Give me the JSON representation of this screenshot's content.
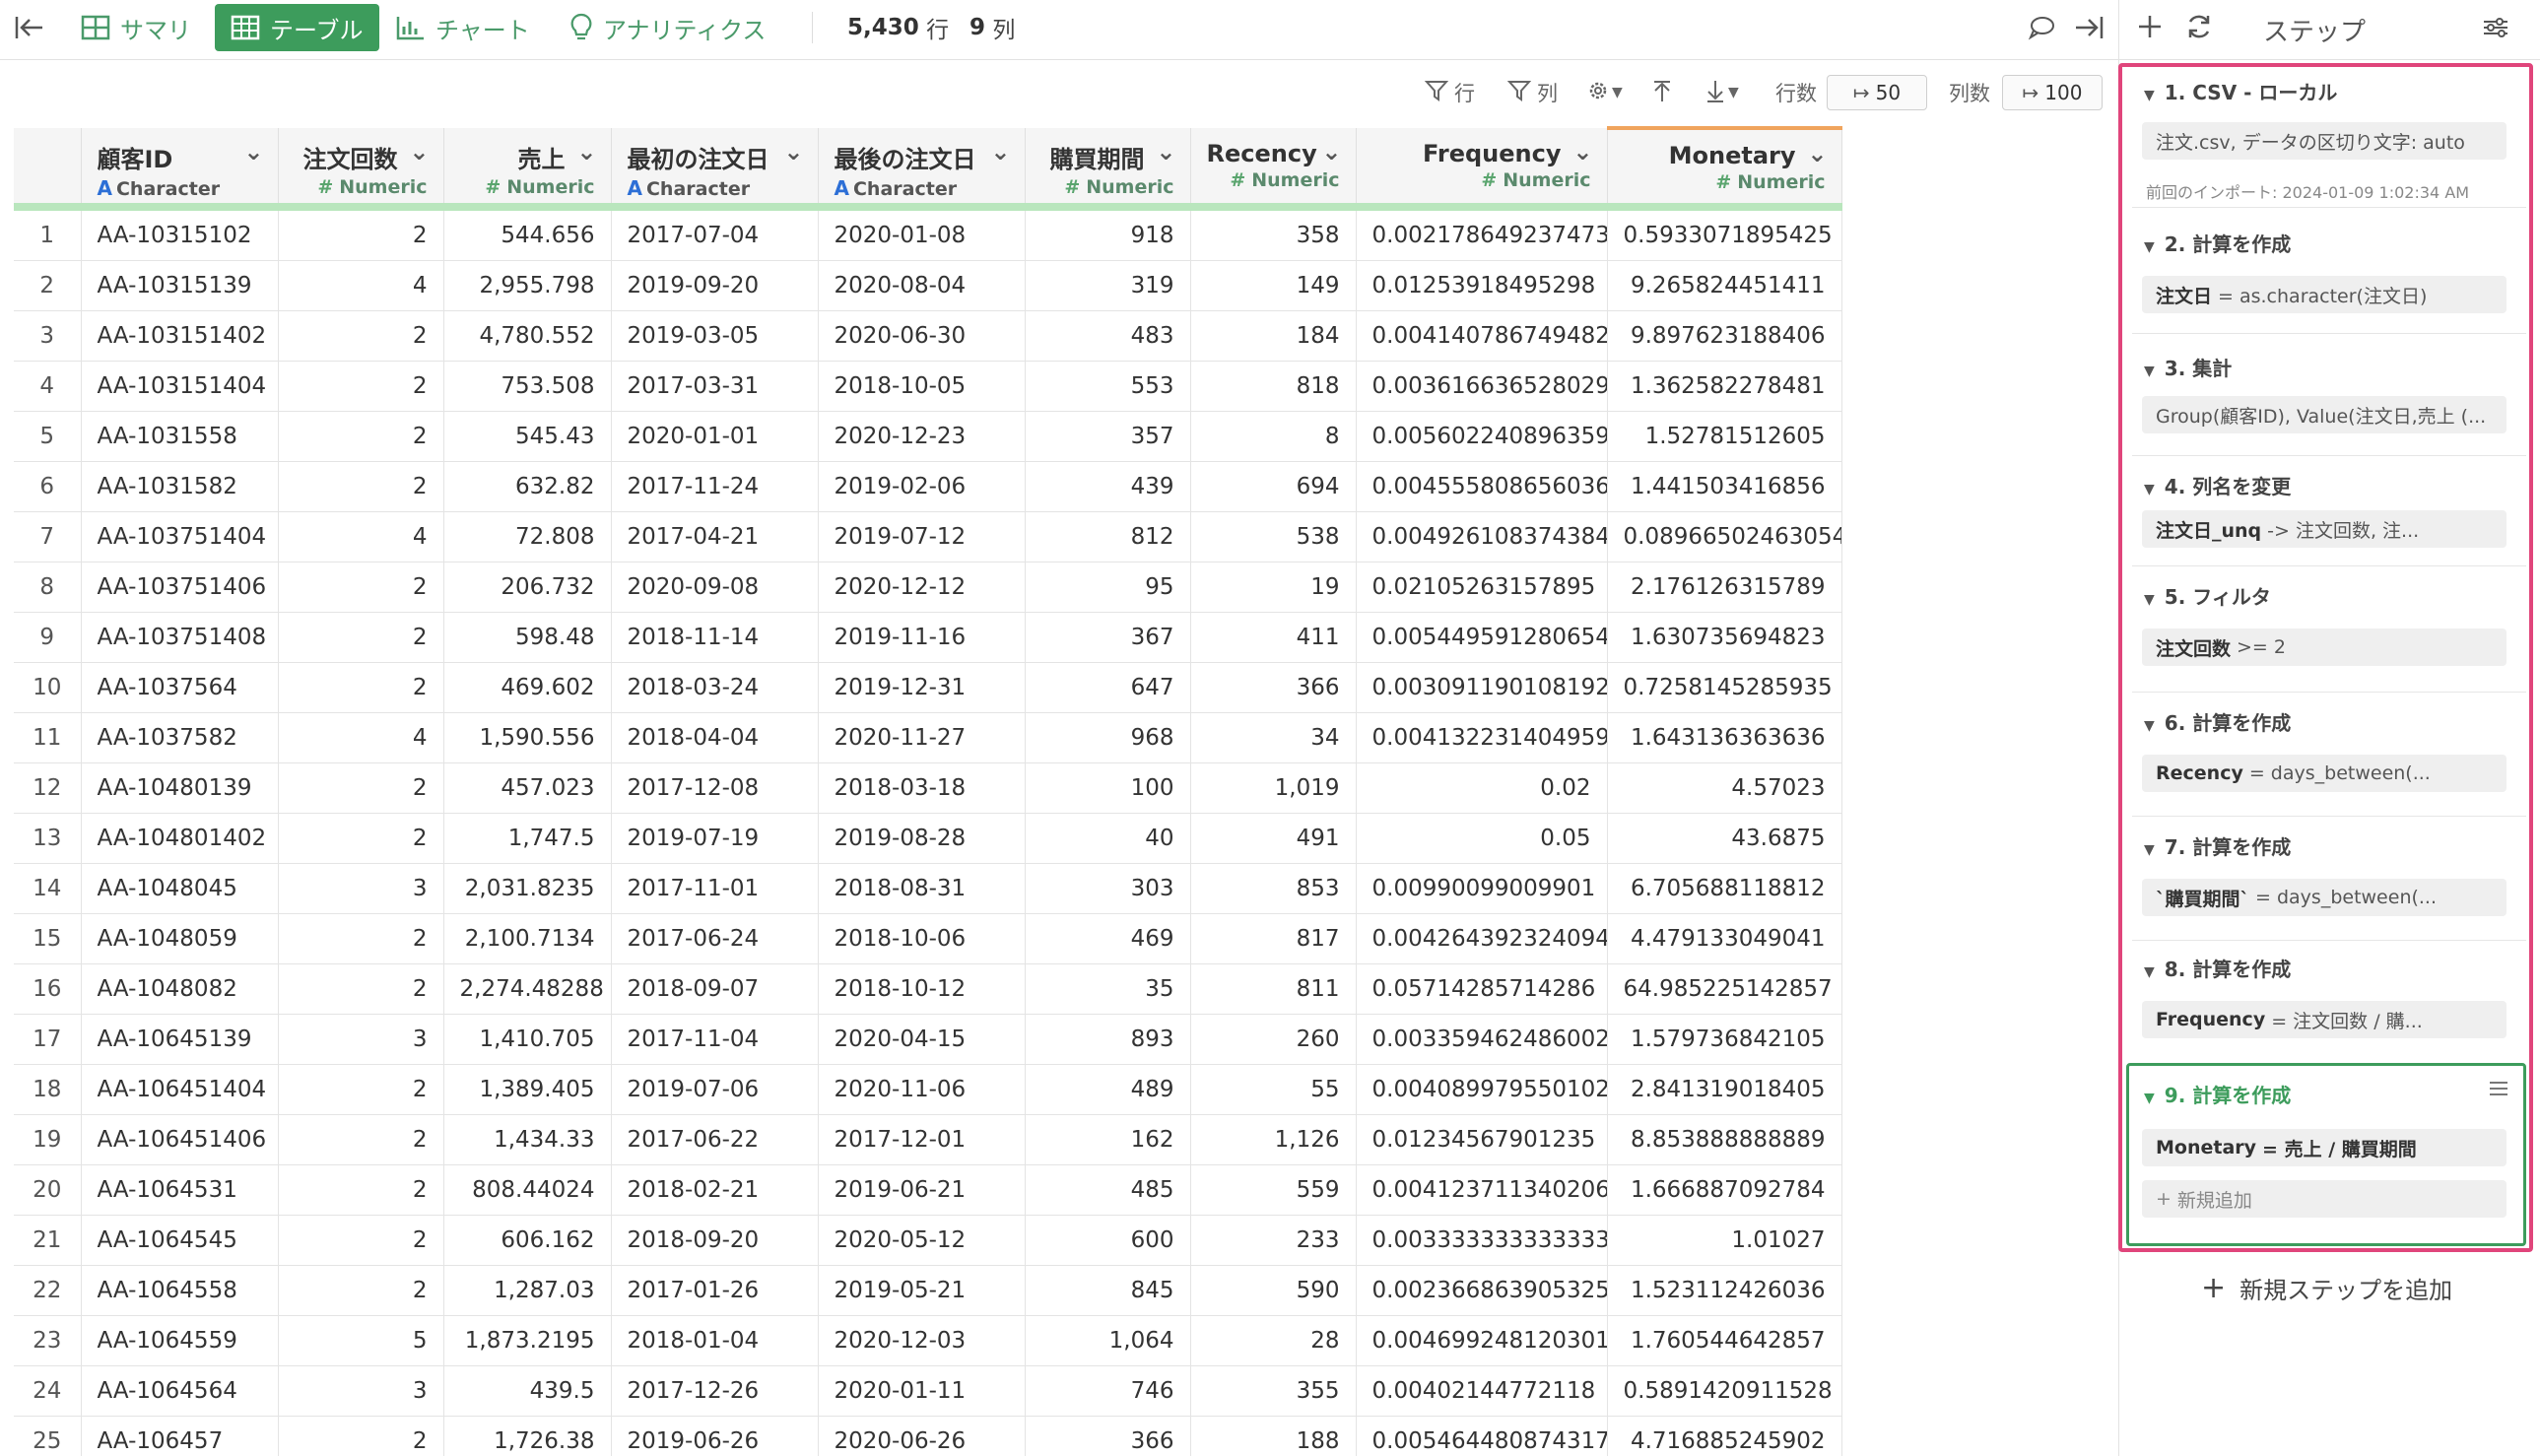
{
  "toolbar": {
    "tabs": [
      {
        "label": "サマリ",
        "icon": "grid-icon"
      },
      {
        "label": "テーブル",
        "icon": "table-icon"
      },
      {
        "label": "チャート",
        "icon": "chart-icon"
      },
      {
        "label": "アナリティクス",
        "icon": "lightbulb-icon"
      }
    ],
    "rows_value": "5,430",
    "rows_unit": "行",
    "cols_value": "9",
    "cols_unit": "列"
  },
  "data_toolbar": {
    "row_filter": "行",
    "col_filter": "列",
    "rows_label": "行数",
    "rows_count": "50",
    "cols_label": "列数",
    "cols_count": "100"
  },
  "table": {
    "columns": [
      {
        "name": "顧客ID",
        "type": "Character"
      },
      {
        "name": "注文回数",
        "type": "Numeric"
      },
      {
        "name": "売上",
        "type": "Numeric"
      },
      {
        "name": "最初の注文日",
        "type": "Character"
      },
      {
        "name": "最後の注文日",
        "type": "Character"
      },
      {
        "name": "購買期間",
        "type": "Numeric"
      },
      {
        "name": "Recency",
        "type": "Numeric"
      },
      {
        "name": "Frequency",
        "type": "Numeric"
      },
      {
        "name": "Monetary",
        "type": "Numeric"
      }
    ],
    "rows": [
      [
        "1",
        "AA-10315102",
        "2",
        "544.656",
        "2017-07-04",
        "2020-01-08",
        "918",
        "358",
        "0.002178649237473",
        "0.5933071895425"
      ],
      [
        "2",
        "AA-10315139",
        "4",
        "2,955.798",
        "2019-09-20",
        "2020-08-04",
        "319",
        "149",
        "0.01253918495298",
        "9.265824451411"
      ],
      [
        "3",
        "AA-103151402",
        "2",
        "4,780.552",
        "2019-03-05",
        "2020-06-30",
        "483",
        "184",
        "0.004140786749482",
        "9.897623188406"
      ],
      [
        "4",
        "AA-103151404",
        "2",
        "753.508",
        "2017-03-31",
        "2018-10-05",
        "553",
        "818",
        "0.003616636528029",
        "1.362582278481"
      ],
      [
        "5",
        "AA-1031558",
        "2",
        "545.43",
        "2020-01-01",
        "2020-12-23",
        "357",
        "8",
        "0.005602240896359",
        "1.52781512605"
      ],
      [
        "6",
        "AA-1031582",
        "2",
        "632.82",
        "2017-11-24",
        "2019-02-06",
        "439",
        "694",
        "0.004555808656036",
        "1.441503416856"
      ],
      [
        "7",
        "AA-103751404",
        "4",
        "72.808",
        "2017-04-21",
        "2019-07-12",
        "812",
        "538",
        "0.004926108374384",
        "0.08966502463054"
      ],
      [
        "8",
        "AA-103751406",
        "2",
        "206.732",
        "2020-09-08",
        "2020-12-12",
        "95",
        "19",
        "0.02105263157895",
        "2.176126315789"
      ],
      [
        "9",
        "AA-103751408",
        "2",
        "598.48",
        "2018-11-14",
        "2019-11-16",
        "367",
        "411",
        "0.005449591280654",
        "1.630735694823"
      ],
      [
        "10",
        "AA-1037564",
        "2",
        "469.602",
        "2018-03-24",
        "2019-12-31",
        "647",
        "366",
        "0.003091190108192",
        "0.7258145285935"
      ],
      [
        "11",
        "AA-1037582",
        "4",
        "1,590.556",
        "2018-04-04",
        "2020-11-27",
        "968",
        "34",
        "0.004132231404959",
        "1.643136363636"
      ],
      [
        "12",
        "AA-10480139",
        "2",
        "457.023",
        "2017-12-08",
        "2018-03-18",
        "100",
        "1,019",
        "0.02",
        "4.57023"
      ],
      [
        "13",
        "AA-104801402",
        "2",
        "1,747.5",
        "2019-07-19",
        "2019-08-28",
        "40",
        "491",
        "0.05",
        "43.6875"
      ],
      [
        "14",
        "AA-1048045",
        "3",
        "2,031.8235",
        "2017-11-01",
        "2018-08-31",
        "303",
        "853",
        "0.00990099009901",
        "6.705688118812"
      ],
      [
        "15",
        "AA-1048059",
        "2",
        "2,100.7134",
        "2017-06-24",
        "2018-10-06",
        "469",
        "817",
        "0.004264392324094",
        "4.479133049041"
      ],
      [
        "16",
        "AA-1048082",
        "2",
        "2,274.48288",
        "2018-09-07",
        "2018-10-12",
        "35",
        "811",
        "0.05714285714286",
        "64.985225142857"
      ],
      [
        "17",
        "AA-10645139",
        "3",
        "1,410.705",
        "2017-11-04",
        "2020-04-15",
        "893",
        "260",
        "0.003359462486002",
        "1.579736842105"
      ],
      [
        "18",
        "AA-106451404",
        "2",
        "1,389.405",
        "2019-07-06",
        "2020-11-06",
        "489",
        "55",
        "0.004089979550102",
        "2.841319018405"
      ],
      [
        "19",
        "AA-106451406",
        "2",
        "1,434.33",
        "2017-06-22",
        "2017-12-01",
        "162",
        "1,126",
        "0.01234567901235",
        "8.853888888889"
      ],
      [
        "20",
        "AA-1064531",
        "2",
        "808.44024",
        "2018-02-21",
        "2019-06-21",
        "485",
        "559",
        "0.004123711340206",
        "1.666887092784"
      ],
      [
        "21",
        "AA-1064545",
        "2",
        "606.162",
        "2018-09-20",
        "2020-05-12",
        "600",
        "233",
        "0.003333333333333",
        "1.01027"
      ],
      [
        "22",
        "AA-1064558",
        "2",
        "1,287.03",
        "2017-01-26",
        "2019-05-21",
        "845",
        "590",
        "0.002366863905325",
        "1.523112426036"
      ],
      [
        "23",
        "AA-1064559",
        "5",
        "1,873.2195",
        "2018-01-04",
        "2020-12-03",
        "1,064",
        "28",
        "0.004699248120301",
        "1.760544642857"
      ],
      [
        "24",
        "AA-1064564",
        "3",
        "439.5",
        "2017-12-26",
        "2020-01-11",
        "746",
        "355",
        "0.00402144772118",
        "0.5891420911528"
      ],
      [
        "25",
        "AA-106457",
        "2",
        "1,726.38",
        "2019-06-26",
        "2020-06-26",
        "366",
        "188",
        "0.005464480874317",
        "4.716885245902"
      ]
    ]
  },
  "steps_panel": {
    "title": "ステップ",
    "steps": [
      {
        "title": "1. CSV - ローカル",
        "body_bold": "",
        "body": "注文.csv, データの区切り文字: auto",
        "note": "前回のインポート: 2024-01-09 1:02:34 AM"
      },
      {
        "title": "2. 計算を作成",
        "body_bold": "注文日",
        "body": "= as.character(注文日)"
      },
      {
        "title": "3. 集計",
        "body_bold": "",
        "body": "Group(顧客ID), Value(注文日,売上 (..."
      },
      {
        "title": "4. 列名を変更",
        "body_bold": "注文日_unq",
        "body": "-> 注文回数, 注..."
      },
      {
        "title": "5. フィルタ",
        "body_bold": "注文回数",
        "body": ">= 2"
      },
      {
        "title": "6. 計算を作成",
        "body_bold": "Recency",
        "body": "= days_between(..."
      },
      {
        "title": "7. 計算を作成",
        "body_bold": "`購買期間`",
        "body": "= days_between(..."
      },
      {
        "title": "8. 計算を作成",
        "body_bold": "Frequency",
        "body": "= 注文回数 / 購..."
      },
      {
        "title": "9. 計算を作成",
        "body_bold": "Monetary",
        "body": "= 売上 / 購買期間"
      }
    ],
    "new_add": "新規追加",
    "add_step": "新規ステップを追加"
  },
  "colors": {
    "accent_green": "#3d9c5c",
    "highlight_pink": "#e0457b",
    "header_underline": "#b9e6bd",
    "orange_col": "#f0a45d"
  }
}
